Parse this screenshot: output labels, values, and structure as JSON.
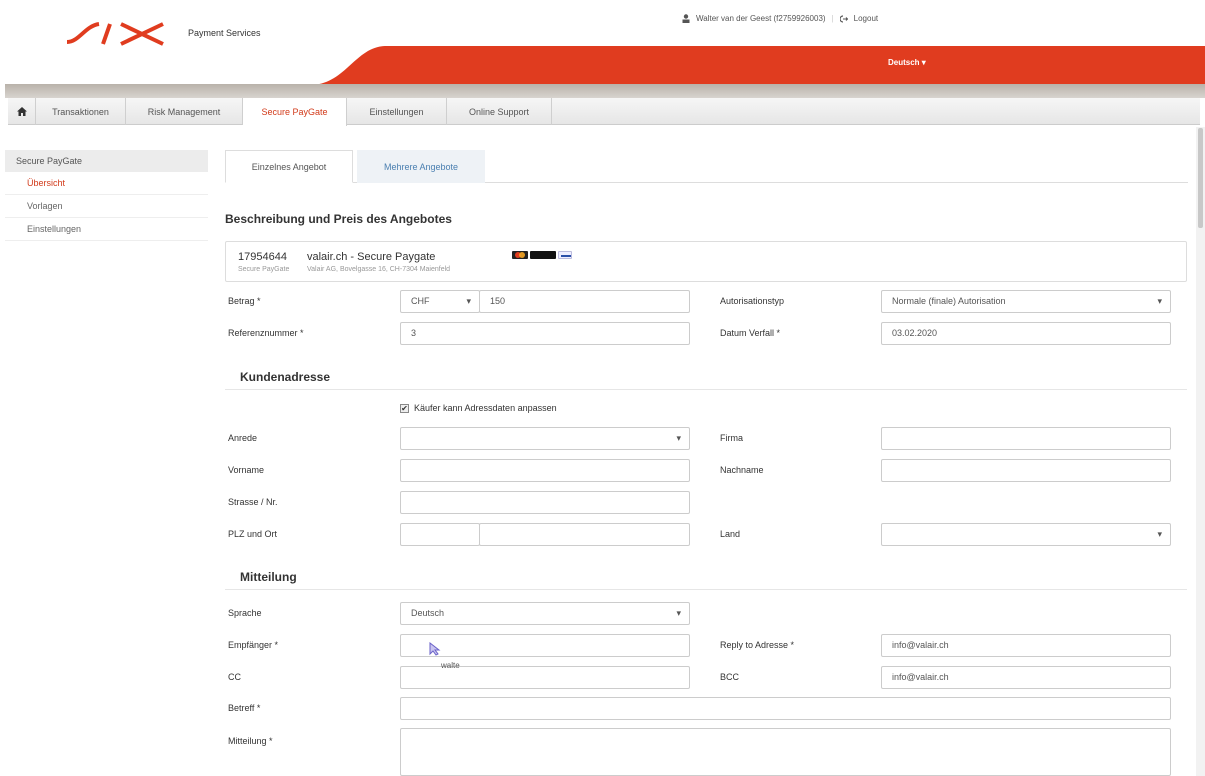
{
  "brand": {
    "logo_text": "SIX",
    "subtitle": "Payment Services",
    "red": "#e03c1f"
  },
  "header": {
    "user_label": "Walter van der Geest (f2759926003)",
    "logout_label": "Logout",
    "language_label": "Deutsch"
  },
  "main_tabs": [
    {
      "label": "Transaktionen"
    },
    {
      "label": "Risk Management"
    },
    {
      "label": "Secure PayGate"
    },
    {
      "label": "Einstellungen"
    },
    {
      "label": "Online Support"
    }
  ],
  "sidebar": {
    "title": "Secure PayGate",
    "items": [
      {
        "label": "Übersicht"
      },
      {
        "label": "Vorlagen"
      },
      {
        "label": "Einstellungen"
      }
    ]
  },
  "inner_tabs": [
    {
      "label": "Einzelnes Angebot"
    },
    {
      "label": "Mehrere Angebote"
    }
  ],
  "section_offer": {
    "title": "Beschreibung und Preis des Angebotes",
    "merchant_id": "17954644",
    "merchant_id_sub": "Secure PayGate",
    "shop_name": "valair.ch - Secure Paygate",
    "shop_address": "Valair AG, Bovelgasse 16, CH-7304 Maienfeld",
    "betrag_label": "Betrag *",
    "currency": "CHF",
    "amount": "150",
    "autorisationstyp_label": "Autorisationstyp",
    "autorisationstyp_value": "Normale (finale) Autorisation",
    "referenz_label": "Referenznummer *",
    "referenz_value": "3",
    "verfall_label": "Datum Verfall *",
    "verfall_value": "03.02.2020"
  },
  "section_address": {
    "title": "Kundenadresse",
    "checkbox_label": "Käufer kann Adressdaten anpassen",
    "anrede_label": "Anrede",
    "firma_label": "Firma",
    "vorname_label": "Vorname",
    "nachname_label": "Nachname",
    "strasse_label": "Strasse / Nr.",
    "plz_label": "PLZ und Ort",
    "land_label": "Land"
  },
  "section_message": {
    "title": "Mitteilung",
    "sprache_label": "Sprache",
    "sprache_value": "Deutsch",
    "empfaenger_label": "Empfänger *",
    "autocomplete_text": "walte",
    "reply_label": "Reply to Adresse *",
    "reply_value": "info@valair.ch",
    "cc_label": "CC",
    "bcc_label": "BCC",
    "bcc_value": "info@valair.ch",
    "betreff_label": "Betreff *",
    "mitteilung_label": "Mitteilung *"
  }
}
